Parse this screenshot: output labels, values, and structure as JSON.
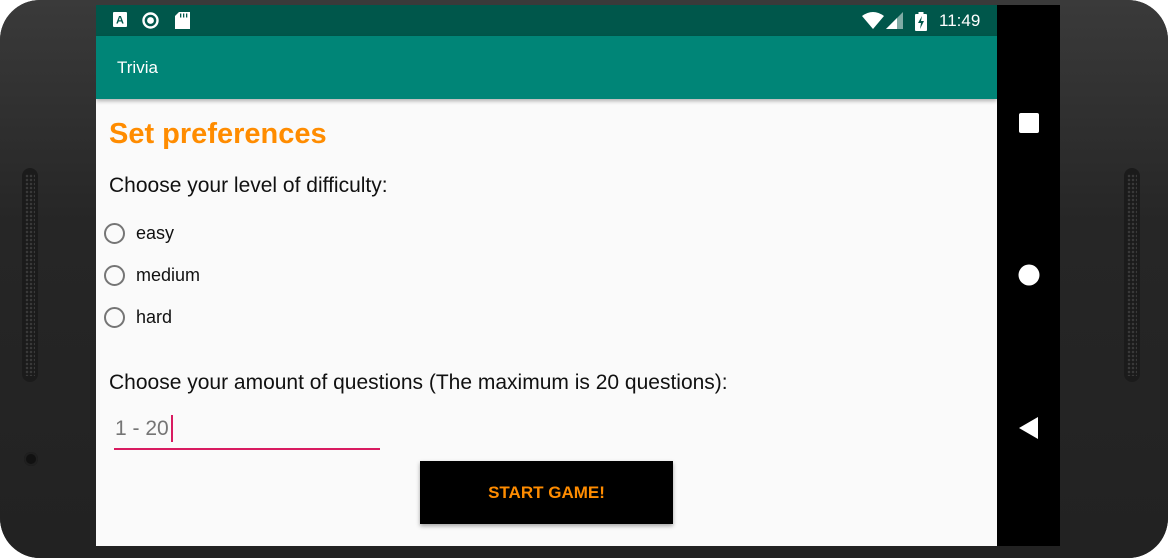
{
  "status_bar": {
    "time": "11:49",
    "icons": [
      "text-a-icon",
      "sync-circle-icon",
      "sd-card-icon",
      "wifi-icon",
      "cell-signal-icon",
      "battery-charging-icon"
    ]
  },
  "app_bar": {
    "title": "Trivia"
  },
  "main": {
    "heading": "Set preferences",
    "difficulty_prompt": "Choose your level of difficulty:",
    "difficulty_options": [
      {
        "label": "easy",
        "checked": false
      },
      {
        "label": "medium",
        "checked": false
      },
      {
        "label": "hard",
        "checked": false
      }
    ],
    "questions_prompt": "Choose your amount of questions (The maximum is 20 questions):",
    "questions_input": {
      "placeholder": "1 - 20",
      "value": ""
    },
    "start_button": {
      "label": "START GAME!"
    }
  },
  "navigation_bar": {
    "buttons": [
      "recents-square-icon",
      "home-circle-icon",
      "back-triangle-icon"
    ]
  },
  "colors": {
    "status_bar": "#00574b",
    "app_bar": "#008577",
    "heading": "#ff8c00",
    "accent": "#d81b60",
    "button_bg": "#000000",
    "button_text": "#ff8c00"
  }
}
